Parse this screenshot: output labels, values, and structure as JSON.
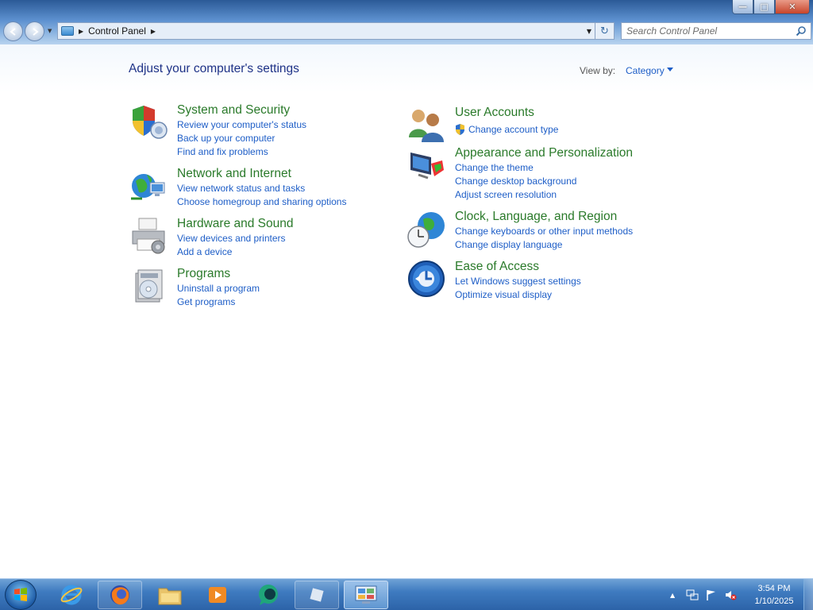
{
  "window": {
    "minimize_glyph": "—",
    "maximize_glyph": "□",
    "close_glyph": "✕"
  },
  "address_bar": {
    "path": [
      "Control Panel"
    ],
    "refresh_glyph": "↻"
  },
  "search": {
    "placeholder": "Search Control Panel"
  },
  "main": {
    "page_title": "Adjust your computer's settings",
    "view_by_label": "View by:",
    "view_by_value": "Category",
    "left_categories": [
      {
        "title": "System and Security",
        "icon": "shield-icon",
        "links": [
          "Review your computer's status",
          "Back up your computer",
          "Find and fix problems"
        ]
      },
      {
        "title": "Network and Internet",
        "icon": "network-globe-icon",
        "links": [
          "View network status and tasks",
          "Choose homegroup and sharing options"
        ]
      },
      {
        "title": "Hardware and Sound",
        "icon": "printer-icon",
        "links": [
          "View devices and printers",
          "Add a device"
        ]
      },
      {
        "title": "Programs",
        "icon": "programs-disc-icon",
        "links": [
          "Uninstall a program",
          "Get programs"
        ]
      }
    ],
    "right_categories": [
      {
        "title": "User Accounts",
        "icon": "users-icon",
        "links": [
          "Change account type"
        ]
      },
      {
        "title": "Appearance and Personalization",
        "icon": "monitor-paint-icon",
        "links": [
          "Change the theme",
          "Change desktop background",
          "Adjust screen resolution"
        ]
      },
      {
        "title": "Clock, Language, and Region",
        "icon": "clock-globe-icon",
        "links": [
          "Change keyboards or other input methods",
          "Change display language"
        ]
      },
      {
        "title": "Ease of Access",
        "icon": "ease-of-access-icon",
        "links": [
          "Let Windows suggest settings",
          "Optimize visual display"
        ]
      }
    ]
  },
  "taskbar": {
    "items": [
      {
        "name": "internet-explorer",
        "icon": "ie-icon"
      },
      {
        "name": "firefox",
        "icon": "firefox-icon"
      },
      {
        "name": "file-explorer",
        "icon": "folder-icon"
      },
      {
        "name": "media-player",
        "icon": "media-player-icon"
      },
      {
        "name": "app-green",
        "icon": "chat-bubble-icon"
      },
      {
        "name": "app-blank",
        "icon": "app-icon"
      },
      {
        "name": "control-panel",
        "icon": "control-panel-icon"
      }
    ],
    "clock_time": "3:54 PM",
    "clock_date": "1/10/2025"
  },
  "colors": {
    "category_title": "#2a7a2a",
    "link": "#1e5ec7",
    "page_title": "#1e3287"
  }
}
